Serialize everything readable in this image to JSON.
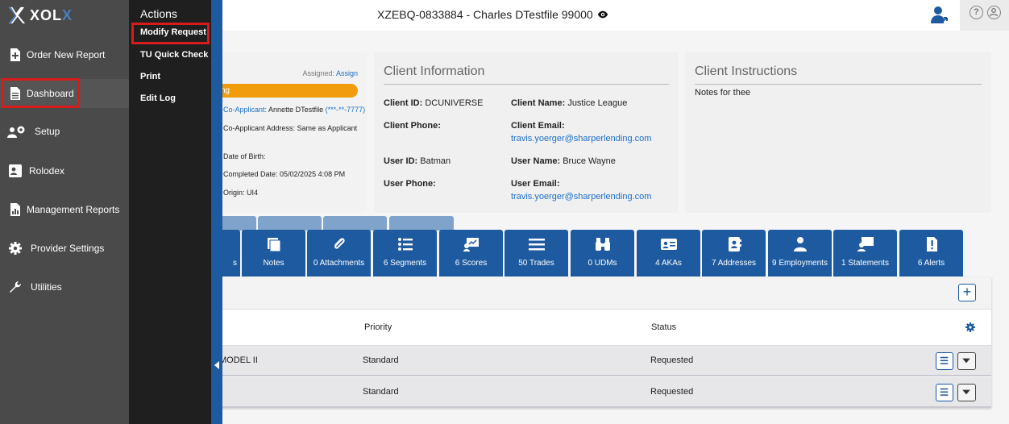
{
  "app": {
    "brand": "XOLX"
  },
  "topbar": {
    "title": "XZEBQ-0833884 - Charles DTestfile 99000",
    "help": "?",
    "account": ""
  },
  "sidebar": {
    "items": [
      {
        "label": "Order New Report",
        "icon": "add-document-icon"
      },
      {
        "label": "Dashboard",
        "icon": "document-icon",
        "highlighted": true
      },
      {
        "label": "Setup",
        "icon": "users-gear-icon"
      },
      {
        "label": "Rolodex",
        "icon": "contact-card-icon"
      },
      {
        "label": "Management Reports",
        "icon": "report-chart-icon"
      },
      {
        "label": "Provider Settings",
        "icon": "gear-icon"
      },
      {
        "label": "Utilities",
        "icon": "wrench-icon"
      }
    ]
  },
  "actions": {
    "title": "Actions",
    "items": [
      {
        "label": "Modify Request",
        "highlighted": true
      },
      {
        "label": "TU Quick Check"
      },
      {
        "label": "Print"
      },
      {
        "label": "Edit Log"
      }
    ]
  },
  "loan_card": {
    "assigned_label": "Assigned:",
    "assign_link": "Assign",
    "status_text": "ng",
    "coapplicant_label": "Co-Applicant:",
    "coapplicant_name": "Annette DTestfile",
    "coapplicant_ssn": "(***-**-7777)",
    "coapplicant_address": "Co-Applicant Address: Same as Applicant",
    "dob": "Date of Birth:",
    "completed": "Completed Date: 05/02/2025 4:08 PM",
    "origin": "Origin: UI4"
  },
  "client_info": {
    "title": "Client Information",
    "client_id_label": "Client ID:",
    "client_id": "DCUNIVERSE",
    "client_name_label": "Client Name:",
    "client_name": "Justice League",
    "client_phone_label": "Client Phone:",
    "client_phone": "",
    "client_email_label": "Client Email:",
    "client_email": "travis.yoerger@sharperlending.com",
    "user_id_label": "User ID:",
    "user_id": "Batman",
    "user_name_label": "User Name:",
    "user_name": "Bruce Wayne",
    "user_phone_label": "User Phone:",
    "user_phone": "",
    "user_email_label": "User Email:",
    "user_email": "travis.yoerger@sharperlending.com"
  },
  "client_instructions": {
    "title": "Client Instructions",
    "text": "Notes for thee"
  },
  "tiles": [
    {
      "label": "s",
      "icon": "partial-icon"
    },
    {
      "label": "Notes",
      "icon": "notes-icon"
    },
    {
      "label": "0 Attachments",
      "icon": "paperclip-icon"
    },
    {
      "label": "6 Segments",
      "icon": "list-icon"
    },
    {
      "label": "6 Scores",
      "icon": "score-board-icon"
    },
    {
      "label": "50 Trades",
      "icon": "lines-icon"
    },
    {
      "label": "0 UDMs",
      "icon": "binoculars-icon"
    },
    {
      "label": "4 AKAs",
      "icon": "id-card-icon"
    },
    {
      "label": "7 Addresses",
      "icon": "address-book-icon"
    },
    {
      "label": "9 Employments",
      "icon": "person-icon"
    },
    {
      "label": "1 Statements",
      "icon": "presenter-icon"
    },
    {
      "label": "6 Alerts",
      "icon": "alert-document-icon"
    }
  ],
  "table": {
    "headers": {
      "priority": "Priority",
      "status": "Status"
    },
    "rows": [
      {
        "name": "MODEL II",
        "priority": "Standard",
        "status": "Requested"
      },
      {
        "name": "",
        "priority": "Standard",
        "status": "Requested"
      }
    ],
    "add_label": "+"
  },
  "colors": {
    "brand_blue": "#1d5aa0",
    "status_orange": "#f09c0c",
    "highlight_red": "#d81b1b",
    "link_blue": "#1a6fc7"
  }
}
